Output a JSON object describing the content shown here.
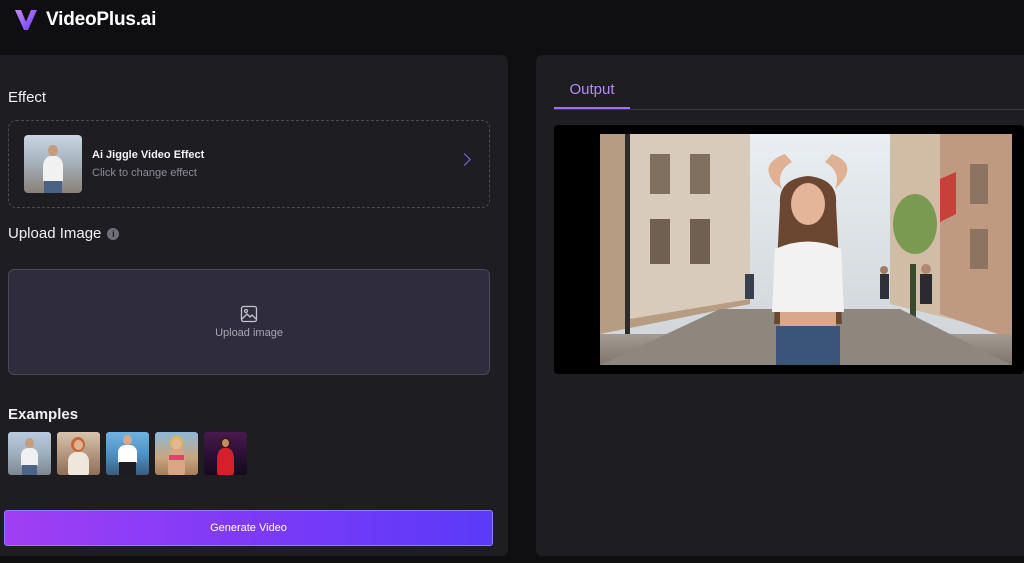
{
  "app": {
    "brand": "VideoPlus.ai",
    "accent": "#8b5cf6"
  },
  "left": {
    "effect_title": "Effect",
    "effect_card": {
      "name": "Ai Jiggle Video Effect",
      "subtitle": "Click to change effect",
      "icon": "chevron-right-icon"
    },
    "upload_title": "Upload Image",
    "upload_info_icon": "info-icon",
    "upload_box": {
      "label": "Upload image",
      "icon": "image-icon"
    },
    "examples_title": "Examples",
    "examples": [
      "example-1",
      "example-2",
      "example-3",
      "example-4",
      "example-5"
    ],
    "generate_label": "Generate Video"
  },
  "right": {
    "tabs": [
      {
        "label": "Output",
        "active": true
      }
    ]
  }
}
